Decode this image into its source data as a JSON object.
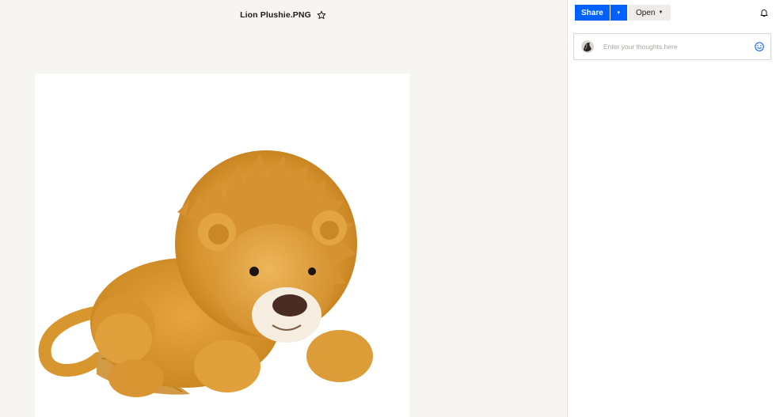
{
  "file": {
    "name": "Lion Plushie.PNG",
    "favorite_icon": "star-outline-icon"
  },
  "preview": {
    "subject": "lion-plush-image"
  },
  "toolbar": {
    "share_label": "Share",
    "share_dropdown_icon": "caret-down-icon",
    "open_label": "Open",
    "open_dropdown_icon": "caret-down-icon",
    "notifications_icon": "bell-icon"
  },
  "comments": {
    "placeholder": "Enter your thoughts here",
    "avatar_icon": "user-avatar",
    "emoji_icon": "smiley-icon"
  },
  "colors": {
    "accent": "#0061fe",
    "viewer_bg": "#f7f5f2",
    "panel_bg": "#ffffff"
  }
}
